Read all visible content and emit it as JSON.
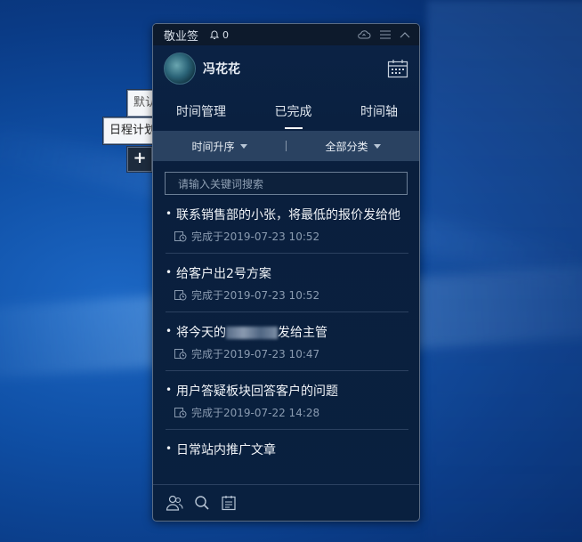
{
  "side_tabs": {
    "default_label": "默认",
    "schedule_label": "日程计划",
    "add_label": "+"
  },
  "window": {
    "app_name": "敬业签",
    "notification_count": "0"
  },
  "user": {
    "name": "冯花花"
  },
  "tabs": [
    {
      "label": "时间管理",
      "active": false
    },
    {
      "label": "已完成",
      "active": true
    },
    {
      "label": "时间轴",
      "active": false
    }
  ],
  "filters": {
    "sort_label": "时间升序",
    "category_label": "全部分类"
  },
  "search": {
    "placeholder": "请输入关键词搜索"
  },
  "items": [
    {
      "title": "联系销售部的小张，将最低的报价发给他",
      "completed": "完成于2019-07-23 10:52"
    },
    {
      "title": "给客户出2号方案",
      "completed": "完成于2019-07-23 10:52"
    },
    {
      "title_before": "将今天的",
      "title_after": "发给主管",
      "completed": "完成于2019-07-23 10:47"
    },
    {
      "title": "用户答疑板块回答客户的问题",
      "completed": "完成于2019-07-22 14:28"
    },
    {
      "title": "日常站内推广文章",
      "completed": ""
    }
  ],
  "colors": {
    "accent": "#ffffff",
    "panel_bg": "#0a1f3d",
    "filter_bar": "#3e5574"
  },
  "icons": {
    "bottom": [
      "contacts-icon",
      "search-icon",
      "notes-icon"
    ]
  }
}
